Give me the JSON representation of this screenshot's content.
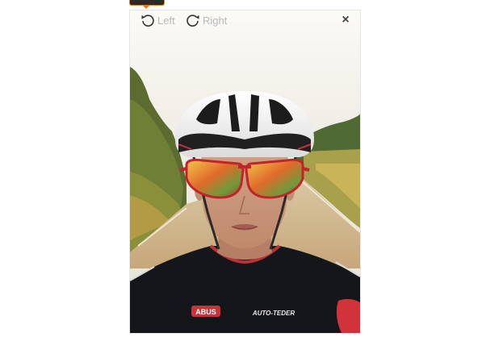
{
  "toolbar": {
    "rotate_left_label": "Left",
    "rotate_right_label": "Right",
    "close_glyph": "×",
    "rotate_left_icon": "rotate-ccw-icon",
    "rotate_right_icon": "rotate-cw-icon"
  },
  "photo": {
    "jersey_logo_left": "ABUS",
    "jersey_logo_right": "AUTO-TEDER"
  },
  "colors": {
    "toolbar_text": "#b9b9b9",
    "close_icon": "#444444",
    "accent_tab": "#e07a1a"
  }
}
